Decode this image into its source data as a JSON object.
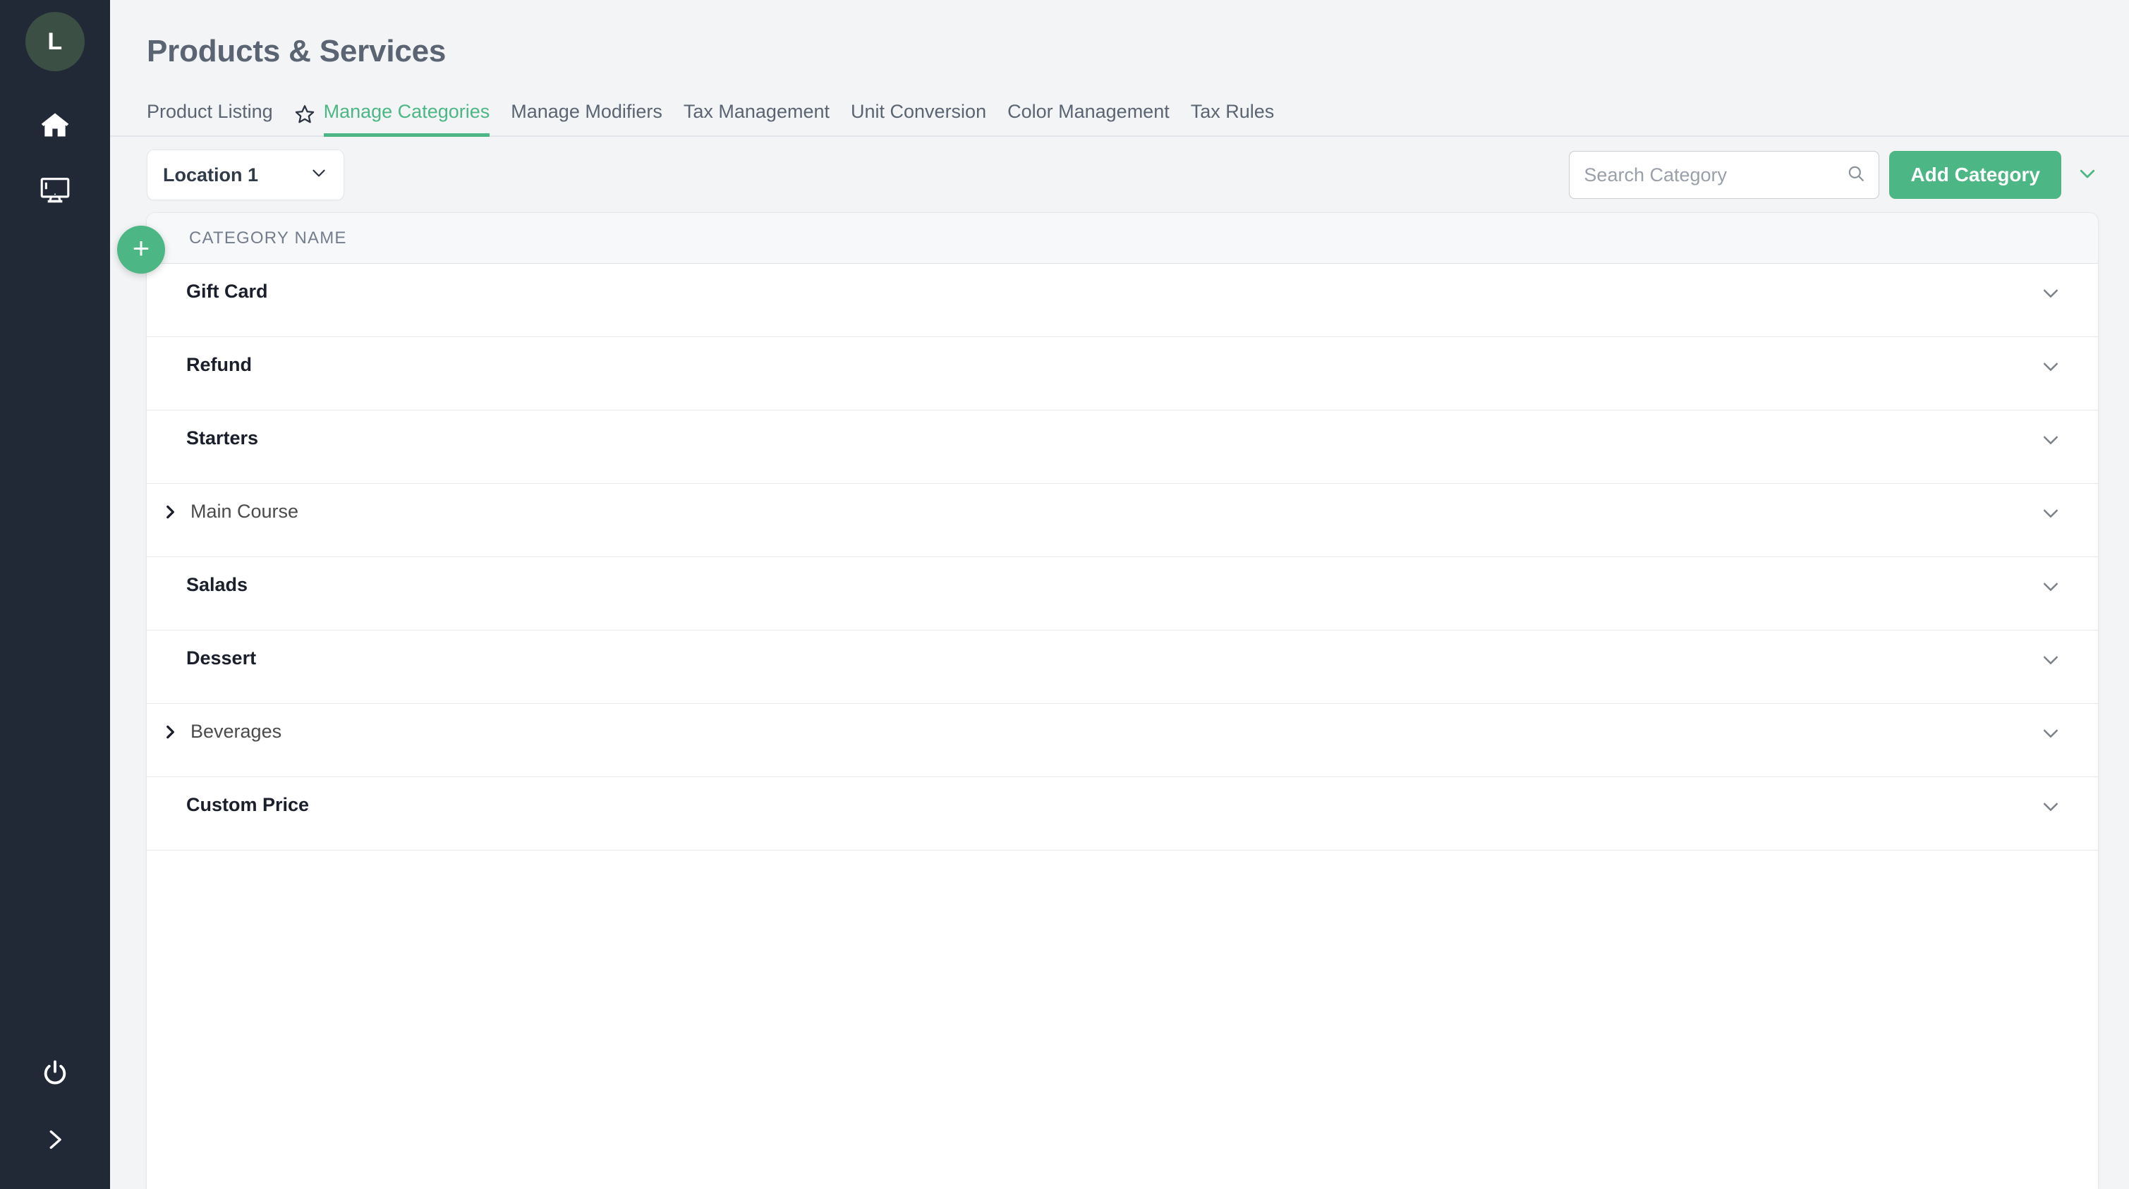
{
  "sidebar": {
    "avatar_label": "L",
    "items": [
      {
        "name": "home-icon",
        "label": "Home"
      },
      {
        "name": "monitor-icon",
        "label": "Display"
      }
    ],
    "bottom_items": [
      {
        "name": "power-icon",
        "label": "Power"
      },
      {
        "name": "expand-sidebar-icon",
        "label": "Expand"
      }
    ]
  },
  "header": {
    "title": "Products & Services"
  },
  "tabs": [
    {
      "label": "Product Listing",
      "active": false
    },
    {
      "label": "Manage Categories",
      "active": true
    },
    {
      "label": "Manage Modifiers",
      "active": false
    },
    {
      "label": "Tax Management",
      "active": false
    },
    {
      "label": "Unit Conversion",
      "active": false
    },
    {
      "label": "Color Management",
      "active": false
    },
    {
      "label": "Tax Rules",
      "active": false
    }
  ],
  "toolbar": {
    "location_value": "Location 1",
    "search_placeholder": "Search Category",
    "search_value": "",
    "add_label": "Add Category"
  },
  "table": {
    "column_header": "CATEGORY NAME",
    "add_fab_label": "+",
    "rows": [
      {
        "name": "Gift Card",
        "expandable": false
      },
      {
        "name": "Refund",
        "expandable": false
      },
      {
        "name": "Starters",
        "expandable": false
      },
      {
        "name": "Main Course",
        "expandable": true
      },
      {
        "name": "Salads",
        "expandable": false
      },
      {
        "name": "Dessert",
        "expandable": false
      },
      {
        "name": "Beverages",
        "expandable": true
      },
      {
        "name": "Custom Price",
        "expandable": false
      }
    ]
  },
  "colors": {
    "sidebar_bg": "#212936",
    "avatar_bg": "#3b4f45",
    "accent_green": "#4db685",
    "title_gray": "#5b6472",
    "page_bg": "#f2f4f6"
  }
}
